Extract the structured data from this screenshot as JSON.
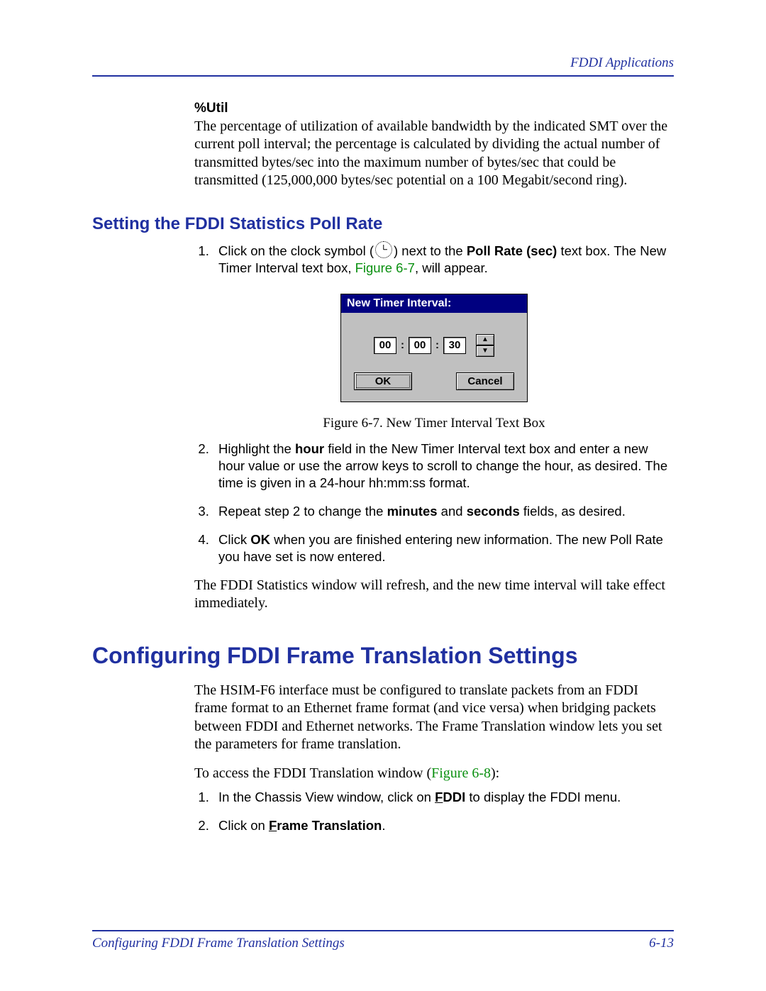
{
  "header": {
    "right": "FDDI Applications"
  },
  "util": {
    "heading": "%Util",
    "body": "The percentage of utilization of available bandwidth by the indicated SMT over the current poll interval; the percentage is calculated by dividing the actual number of transmitted bytes/sec into the maximum number of bytes/sec that could be transmitted (125,000,000 bytes/sec potential on a 100 Megabit/second ring)."
  },
  "sec1": {
    "title": "Setting the FDDI Statistics Poll Rate",
    "step1_a": "Click on the clock symbol (",
    "step1_b": ") next to the ",
    "step1_bold": "Poll Rate (sec)",
    "step1_c": " text box. The New Timer Interval text box, ",
    "step1_link": "Figure 6-7",
    "step1_d": ", will appear.",
    "step2_a": "Highlight the ",
    "step2_bold": "hour",
    "step2_b": " field in the New Timer Interval text box and enter a new hour value or use the arrow keys to scroll to change the hour, as desired. The time is given in a 24-hour hh:mm:ss format.",
    "step3_a": "Repeat step 2 to change the ",
    "step3_bold1": "minutes",
    "step3_b": " and ",
    "step3_bold2": "seconds",
    "step3_c": " fields, as desired.",
    "step4_a": "Click ",
    "step4_bold": "OK",
    "step4_b": " when you are finished entering new information. The new Poll Rate you have set is now entered.",
    "closing": "The FDDI Statistics window will refresh, and the new time interval will take effect immediately."
  },
  "dialog": {
    "title": "New Timer Interval:",
    "hh": "00",
    "mm": "00",
    "ss": "30",
    "ok": "OK",
    "cancel": "Cancel",
    "caption": "Figure 6-7. New Timer Interval Text Box"
  },
  "sec2": {
    "title": "Configuring FDDI Frame Translation Settings",
    "p1": "The HSIM-F6 interface must be configured to translate packets from an FDDI frame format to an Ethernet frame format (and vice versa) when bridging packets between FDDI and Ethernet networks. The Frame Translation window lets you set the parameters for frame translation.",
    "p2_a": "To access the FDDI Translation window (",
    "p2_link": "Figure 6-8",
    "p2_b": "):",
    "step1_a": "In the Chassis View window, click on ",
    "step1_u": "F",
    "step1_b": "DDI",
    "step1_c": " to display the FDDI menu.",
    "step2_a": "Click on ",
    "step2_u": "F",
    "step2_b": "rame Translation",
    "step2_c": "."
  },
  "footer": {
    "left": "Configuring FDDI Frame Translation Settings",
    "right": "6-13"
  }
}
